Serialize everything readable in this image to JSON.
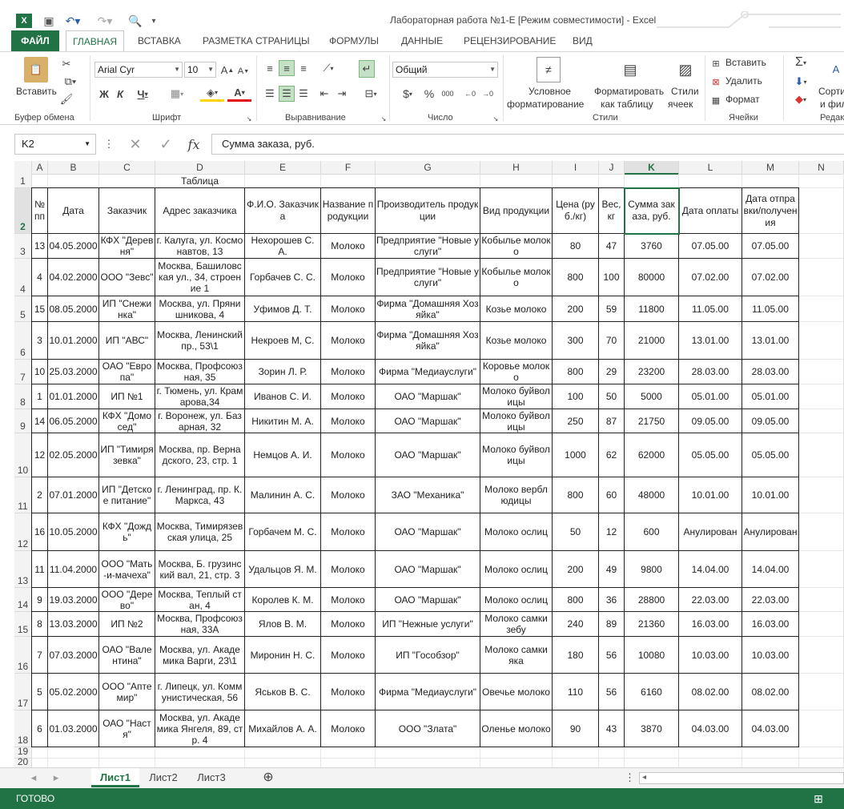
{
  "window": {
    "title": "Лабораторная работа №1-E  [Режим совместимости] - Excel"
  },
  "ribbon_tabs": [
    "ФАЙЛ",
    "ГЛАВНАЯ",
    "ВСТАВКА",
    "РАЗМЕТКА СТРАНИЦЫ",
    "ФОРМУЛЫ",
    "ДАННЫЕ",
    "РЕЦЕНЗИРОВАНИЕ",
    "ВИД"
  ],
  "ribbon": {
    "paste": "Вставить",
    "font_name": "Arial Cyr",
    "font_size": "10",
    "number_format": "Общий",
    "conditional_1": "Условное",
    "conditional_2": "форматирование",
    "format_table_1": "Форматировать",
    "format_table_2": "как таблицу",
    "styles_1": "Стили",
    "styles_2": "ячеек",
    "insert": "Вставить",
    "delete": "Удалить",
    "format": "Формат",
    "sort_1": "Сорти",
    "sort_2": "и фил",
    "groups": {
      "clipboard": "Буфер обмена",
      "font": "Шрифт",
      "align": "Выравнивание",
      "number": "Число",
      "styles": "Стили",
      "cells": "Ячейки",
      "edit": "Редак"
    }
  },
  "formula_bar": {
    "name_box": "K2",
    "formula": "Сумма заказа, руб."
  },
  "columns": [
    "A",
    "B",
    "C",
    "D",
    "E",
    "F",
    "G",
    "H",
    "I",
    "J",
    "K",
    "L",
    "M",
    "N"
  ],
  "rows": [
    "1",
    "2",
    "3",
    "4",
    "5",
    "6",
    "7",
    "8",
    "9",
    "10",
    "11",
    "12",
    "13",
    "14",
    "15",
    "16",
    "17",
    "18",
    "19",
    "20"
  ],
  "table": {
    "caption": "Таблица",
    "headers": [
      "№ пп",
      "Дата",
      "Заказчик",
      "Адрес заказчика",
      "Ф.И.О. Заказчика",
      "Название продукции",
      "Производитель продукции",
      "Вид продукции",
      "Цена (руб./кг)",
      "Вес, кг",
      "Сумма заказа, руб.",
      "Дата оплаты",
      "Дата отправки/получения"
    ],
    "rows": [
      [
        "13",
        "04.05.2000",
        "КФХ \"Деревня\"",
        "г. Калуга, ул. Космонавтов, 13",
        "Нехорошев С. А.",
        "Молоко",
        "Предприятие \"Новые услуги\"",
        "Кобылье молоко",
        "80",
        "47",
        "3760",
        "07.05.00",
        "07.05.00"
      ],
      [
        "4",
        "04.02.2000",
        "ООО \"Зевс\"",
        "Москва, Башиловская ул., 34, строение 1",
        "Горбачев С. С.",
        "Молоко",
        "Предприятие \"Новые услуги\"",
        "Кобылье молоко",
        "800",
        "100",
        "80000",
        "07.02.00",
        "07.02.00"
      ],
      [
        "15",
        "08.05.2000",
        "ИП \"Снежинка\"",
        "Москва, ул. Прянишникова, 4",
        "Уфимов Д. Т.",
        "Молоко",
        "Фирма \"Домашняя Хозяйка\"",
        "Козье молоко",
        "200",
        "59",
        "11800",
        "11.05.00",
        "11.05.00"
      ],
      [
        "3",
        "10.01.2000",
        "ИП \"АВС\"",
        "Москва, Ленинский пр., 53\\1",
        "Некроев М, С.",
        "Молоко",
        "Фирма \"Домашняя Хозяйка\"",
        "Козье молоко",
        "300",
        "70",
        "21000",
        "13.01.00",
        "13.01.00"
      ],
      [
        "10",
        "25.03.2000",
        "ОАО \"Европа\"",
        "Москва, Профсоюзная, 35",
        "Зорин Л. Р.",
        "Молоко",
        "Фирма \"Медиауслуги\"",
        "Коровье молоко",
        "800",
        "29",
        "23200",
        "28.03.00",
        "28.03.00"
      ],
      [
        "1",
        "01.01.2000",
        "ИП №1",
        "г. Тюмень, ул. Крамарова,34",
        "Иванов С. И.",
        "Молоко",
        "ОАО \"Маршак\"",
        "Молоко буйволицы",
        "100",
        "50",
        "5000",
        "05.01.00",
        "05.01.00"
      ],
      [
        "14",
        "06.05.2000",
        "КФХ \"Домосед\"",
        "г. Воронеж, ул. Базарная, 32",
        "Никитин М. А.",
        "Молоко",
        "ОАО \"Маршак\"",
        "Молоко буйволицы",
        "250",
        "87",
        "21750",
        "09.05.00",
        "09.05.00"
      ],
      [
        "12",
        "02.05.2000",
        "ИП \"Тимирязевка\"",
        "Москва, пр. Вернадского, 23, стр. 1",
        "Немцов А. И.",
        "Молоко",
        "ОАО \"Маршак\"",
        "Молоко буйволицы",
        "1000",
        "62",
        "62000",
        "05.05.00",
        "05.05.00"
      ],
      [
        "2",
        "07.01.2000",
        "ИП \"Детское питание\"",
        "г. Ленинград, пр. К. Маркса, 43",
        "Малинин А. С.",
        "Молоко",
        "ЗАО \"Механика\"",
        "Молоко верблюдицы",
        "800",
        "60",
        "48000",
        "10.01.00",
        "10.01.00"
      ],
      [
        "16",
        "10.05.2000",
        "КФХ \"Дождь\"",
        "Москва, Тимирязевская улица, 25",
        "Горбачем М. С.",
        "Молоко",
        "ОАО \"Маршак\"",
        "Молоко ослиц",
        "50",
        "12",
        "600",
        "Анулирован",
        "Анулирован"
      ],
      [
        "11",
        "11.04.2000",
        "ООО \"Мать-и-мачеха\"",
        "Москва, Б. грузинский вал, 21, стр. 3",
        "Удальцов Я. М.",
        "Молоко",
        "ОАО \"Маршак\"",
        "Молоко ослиц",
        "200",
        "49",
        "9800",
        "14.04.00",
        "14.04.00"
      ],
      [
        "9",
        "19.03.2000",
        "ООО \"Дерево\"",
        "Москва, Теплый стан, 4",
        "Королев К. М.",
        "Молоко",
        "ОАО \"Маршак\"",
        "Молоко ослиц",
        "800",
        "36",
        "28800",
        "22.03.00",
        "22.03.00"
      ],
      [
        "8",
        "13.03.2000",
        "ИП №2",
        "Москва, Профсоюзная, 33А",
        "Ялов В. М.",
        "Молоко",
        "ИП \"Нежные услуги\"",
        "Молоко самки зебу",
        "240",
        "89",
        "21360",
        "16.03.00",
        "16.03.00"
      ],
      [
        "7",
        "07.03.2000",
        "ОАО \"Валентина\"",
        "Москва, ул. Академика Варги, 23\\1",
        "Миронин Н. С.",
        "Молоко",
        "ИП \"Гособзор\"",
        "Молоко самки яка",
        "180",
        "56",
        "10080",
        "10.03.00",
        "10.03.00"
      ],
      [
        "5",
        "05.02.2000",
        "ООО \"Аптемир\"",
        "г. Липецк, ул. Коммунистическая, 56",
        "Яськов В. С.",
        "Молоко",
        "Фирма \"Медиауслуги\"",
        "Овечье молоко",
        "110",
        "56",
        "6160",
        "08.02.00",
        "08.02.00"
      ],
      [
        "6",
        "01.03.2000",
        "ОАО \"Настя\"",
        "Москва, ул. Академика Янгеля, 89, стр. 4",
        "Михайлов А. А.",
        "Молоко",
        "ООО \"Злата\"",
        "Оленье молоко",
        "90",
        "43",
        "3870",
        "04.03.00",
        "04.03.00"
      ]
    ]
  },
  "sheets": [
    "Лист1",
    "Лист2",
    "Лист3"
  ],
  "status": "ГОТОВО"
}
